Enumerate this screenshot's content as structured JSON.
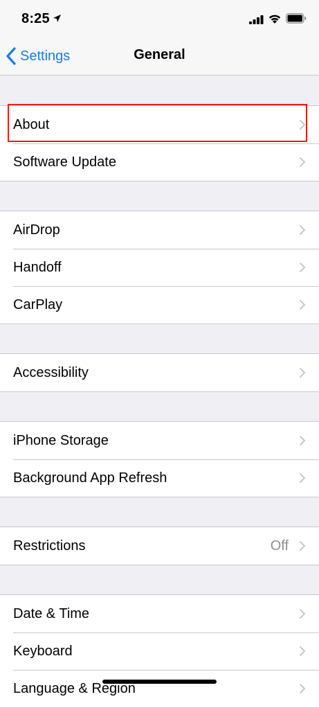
{
  "status_bar": {
    "time": "8:25"
  },
  "nav": {
    "back_label": "Settings",
    "title": "General"
  },
  "groups": [
    {
      "rows": [
        {
          "label": "About",
          "highlighted": true
        },
        {
          "label": "Software Update"
        }
      ]
    },
    {
      "rows": [
        {
          "label": "AirDrop"
        },
        {
          "label": "Handoff"
        },
        {
          "label": "CarPlay"
        }
      ]
    },
    {
      "rows": [
        {
          "label": "Accessibility"
        }
      ]
    },
    {
      "rows": [
        {
          "label": "iPhone Storage"
        },
        {
          "label": "Background App Refresh"
        }
      ]
    },
    {
      "rows": [
        {
          "label": "Restrictions",
          "value": "Off"
        }
      ]
    },
    {
      "rows": [
        {
          "label": "Date & Time"
        },
        {
          "label": "Keyboard"
        },
        {
          "label": "Language & Region"
        }
      ]
    }
  ],
  "colors": {
    "accent": "#1a7ae4",
    "highlight_border": "#e02020",
    "background": "#efeff4",
    "secondary_text": "#8e8e93"
  },
  "icons": {
    "location": "location-arrow-icon",
    "signal": "cellular-signal-icon",
    "wifi": "wifi-icon",
    "battery": "battery-icon",
    "back": "chevron-left-icon",
    "disclosure": "chevron-right-icon"
  }
}
